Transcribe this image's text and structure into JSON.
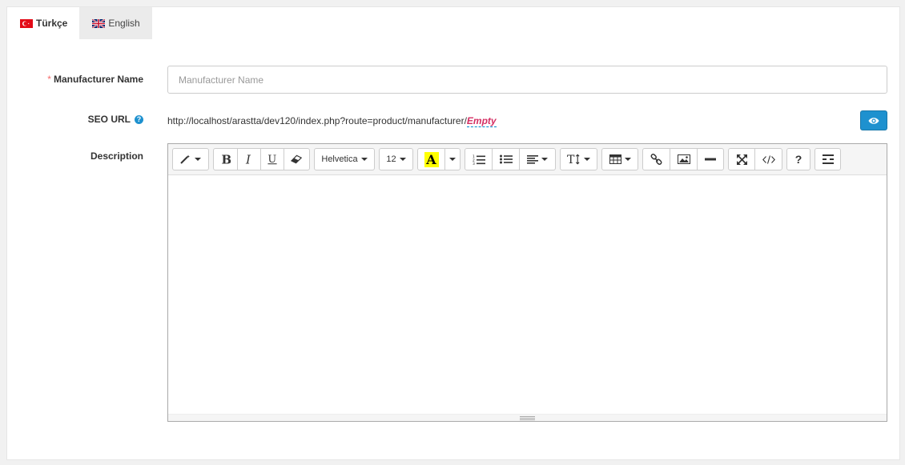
{
  "tabs": [
    {
      "label": "Türkçe",
      "flag": "tr-flag-icon",
      "active": true
    },
    {
      "label": "English",
      "flag": "gb-flag-icon",
      "active": false
    }
  ],
  "form": {
    "manufacturer_name": {
      "required_mark": "*",
      "label": "Manufacturer Name",
      "placeholder": "Manufacturer Name",
      "value": ""
    },
    "seo_url": {
      "label": "SEO URL",
      "help_icon": "question-circle-icon",
      "help_glyph": "?",
      "url_prefix": "http://localhost/arastta/dev120/index.php?route=product/manufacturer/",
      "url_value": "Empty",
      "preview_icon": "eye-icon"
    },
    "description": {
      "label": "Description"
    }
  },
  "editor": {
    "font_family": "Helvetica",
    "font_size": "12",
    "highlight_letter": "A",
    "help_glyph": "?",
    "highlight_color": "#ffff00",
    "content": ""
  },
  "colors": {
    "accent": "#1e91cf",
    "required": "#f56b6b",
    "empty_link": "#d42f63"
  }
}
